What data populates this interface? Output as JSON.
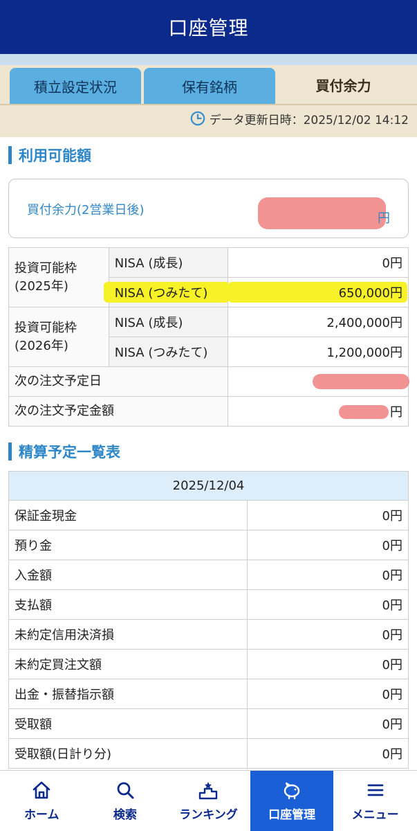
{
  "header": {
    "title": "口座管理"
  },
  "tabs": [
    {
      "label": "積立設定状況"
    },
    {
      "label": "保有銘柄"
    },
    {
      "label": "買付余力"
    }
  ],
  "update": {
    "label": "データ更新日時：2025/12/02 14:12"
  },
  "available": {
    "section_title": "利用可能額",
    "buying_power_label": "買付余力(2営業日後)",
    "buying_power_unit": "円"
  },
  "limits": {
    "year1": {
      "label": "投資可能枠\n(2025年)",
      "rows": [
        {
          "name": "NISA (成長)",
          "value": "0円"
        },
        {
          "name": "NISA (つみたて)",
          "value": "650,000円"
        }
      ]
    },
    "year2": {
      "label": "投資可能枠\n(2026年)",
      "rows": [
        {
          "name": "NISA (成長)",
          "value": "2,400,000円"
        },
        {
          "name": "NISA (つみたて)",
          "value": "1,200,000円"
        }
      ]
    },
    "next_order_date_label": "次の注文予定日",
    "next_order_amount_label": "次の注文予定金額",
    "next_order_amount_unit": "円"
  },
  "settlement": {
    "section_title": "精算予定一覧表",
    "date": "2025/12/04",
    "rows": [
      {
        "label": "保証金現金",
        "value": "0円"
      },
      {
        "label": "預り金",
        "value": "0円"
      },
      {
        "label": "入金額",
        "value": "0円"
      },
      {
        "label": "支払額",
        "value": "0円"
      },
      {
        "label": "未約定信用決済損",
        "value": "0円"
      },
      {
        "label": "未約定買注文額",
        "value": "0円"
      },
      {
        "label": "出金・振替指示額",
        "value": "0円"
      },
      {
        "label": "受取額",
        "value": "0円"
      },
      {
        "label": "受取額(日計り分)",
        "value": "0円"
      }
    ]
  },
  "nav": [
    {
      "label": "ホーム",
      "icon": "home-icon"
    },
    {
      "label": "検索",
      "icon": "search-icon"
    },
    {
      "label": "ランキング",
      "icon": "podium-icon"
    },
    {
      "label": "口座管理",
      "icon": "piggy-bank-icon"
    },
    {
      "label": "メニュー",
      "icon": "hamburger-icon"
    }
  ],
  "colors": {
    "header": "#0c2a8c",
    "accent": "#2c86c8",
    "tab_inactive": "#5aaee0",
    "highlight": "#f7f228",
    "nav_active": "#1a5fd6"
  }
}
